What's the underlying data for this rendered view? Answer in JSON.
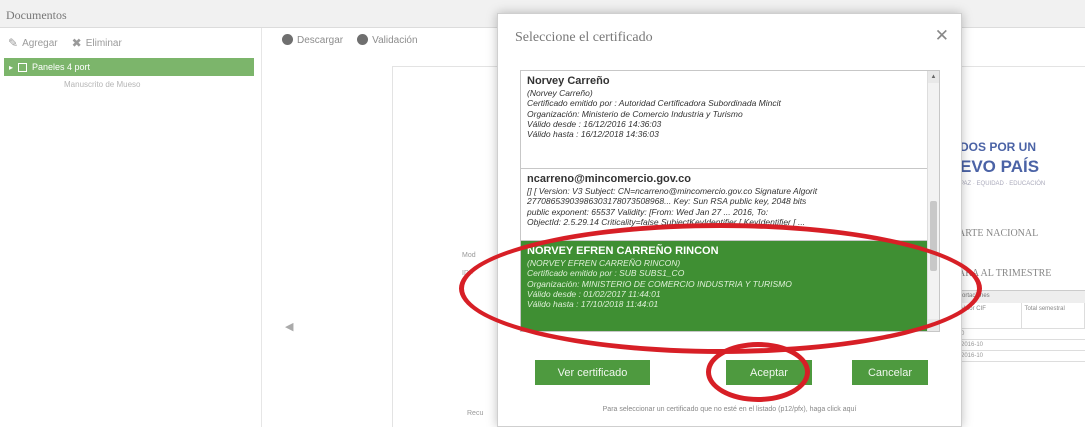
{
  "app": {
    "title": "Documentos"
  },
  "left_toolbar": {
    "add_label": "Agregar",
    "delete_label": "Eliminar"
  },
  "tree": {
    "item_label": "Paneles 4 port",
    "sub_label": "Manuscrito de Mueso"
  },
  "right_toolbar": {
    "download_label": "Descargar",
    "validate_label": "Validación"
  },
  "document": {
    "logo_line1": "DOS POR UN",
    "logo_line2": "EVO PAÍS",
    "logo_sub": "PAZ · EQUIDAD · EDUCACIÓN",
    "heading1": "ARTE NACIONAL",
    "heading2": "ARA AL TRIMESTRE",
    "table_header": "ortaciones",
    "table_cols": [
      "Valor CIF",
      "Total semestral"
    ],
    "table_rows": [
      "0",
      "2016-10",
      "2016-10"
    ],
    "frag_left1": "Mod",
    "frag_left2": "ID–",
    "frag_left3": "Recu"
  },
  "modal": {
    "title": "Seleccione el certificado",
    "close_glyph": "✕",
    "certificates": [
      {
        "name": "Norvey Carreño",
        "sub": "(Norvey Carreño)",
        "lines": [
          "Certificado emitido por : Autoridad Certificadora Subordinada Mincit",
          "Organización: Ministerio de Comercio Industria y Turismo",
          "Válido desde : 16/12/2016 14:36:03",
          "Válido hasta : 16/12/2018 14:36:03"
        ]
      },
      {
        "name": "ncarreno@mincomercio.gov.co",
        "lines": [
          "[] [ Version: V3 Subject: CN=ncarreno@mincomercio.gov.co Signature Algorit",
          "27708653903986303178073508968... Key: Sun RSA public key, 2048 bits",
          "public exponent: 65537 Validity: [From: Wed Jan 27 ... 2016, To:",
          "ObjectId: 2.5.29.14 Criticality=false SubjectKeyIdentifier [ KeyIdentifier [ ..."
        ]
      },
      {
        "name": "NORVEY EFREN CARREÑO RINCON",
        "sub": "(NORVEY EFREN CARREÑO RINCON)",
        "lines": [
          "Certificado emitido por : SUB SUBS1_CO",
          "Organización: MINISTERIO DE COMERCIO INDUSTRIA Y TURISMO",
          "Válido desde : 01/02/2017 11:44:01",
          "Válido hasta : 17/10/2018 11:44:01"
        ]
      }
    ],
    "btn_view": "Ver certificado",
    "btn_accept": "Aceptar",
    "btn_cancel": "Cancelar",
    "footer": "Para seleccionar un certificado que no esté en el listado (p12/pfx), haga click aquí"
  },
  "colors": {
    "green_button": "#4e9a3f",
    "selected_row": "#3f8f33",
    "annotation_red": "#d71f26"
  }
}
